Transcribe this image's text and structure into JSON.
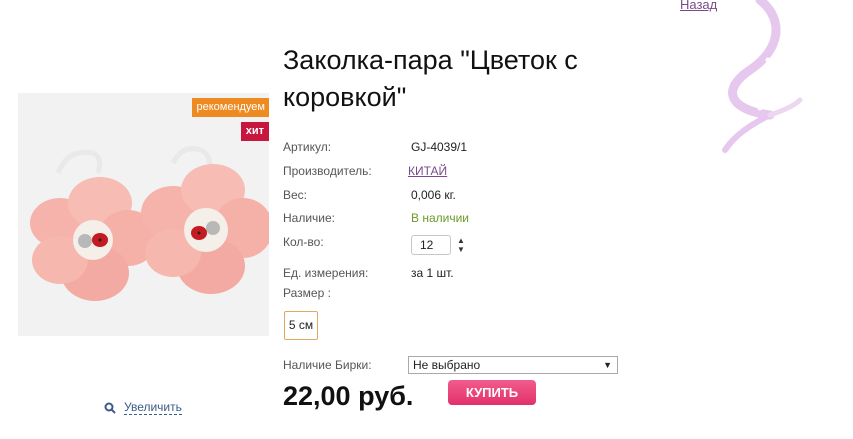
{
  "nav": {
    "back_label": "Назад"
  },
  "product": {
    "title": "Заколка-пара \"Цветок с коровкой\"",
    "badges": {
      "recommended": "рекомендуем",
      "hit": "хит"
    },
    "zoom_label": "Увеличить",
    "image_icon": "flower-hairclip-image"
  },
  "props": {
    "article_label": "Артикул:",
    "article_value": "GJ-4039/1",
    "maker_label": "Производитель:",
    "maker_value": "КИТАЙ",
    "weight_label": "Вес:",
    "weight_value": "0,006 кг.",
    "stock_label": "Наличие:",
    "stock_value": "В наличии",
    "qty_label": "Кол-во:",
    "qty_value": "12",
    "unit_label": "Ед. измерения:",
    "unit_value": "за 1 шт.",
    "size_label": "Размер :",
    "size_option": "5 см"
  },
  "tag": {
    "label": "Наличие Бирки:",
    "selected": "Не выбрано"
  },
  "price": {
    "value": "22,00 руб.",
    "buy_label": "КУПИТЬ"
  },
  "colors": {
    "accent_pink": "#e2316b",
    "badge_orange": "#ee8a22",
    "badge_red": "#c8173f",
    "stock_green": "#6d9a2c",
    "link_purple": "#7b4a8a"
  }
}
